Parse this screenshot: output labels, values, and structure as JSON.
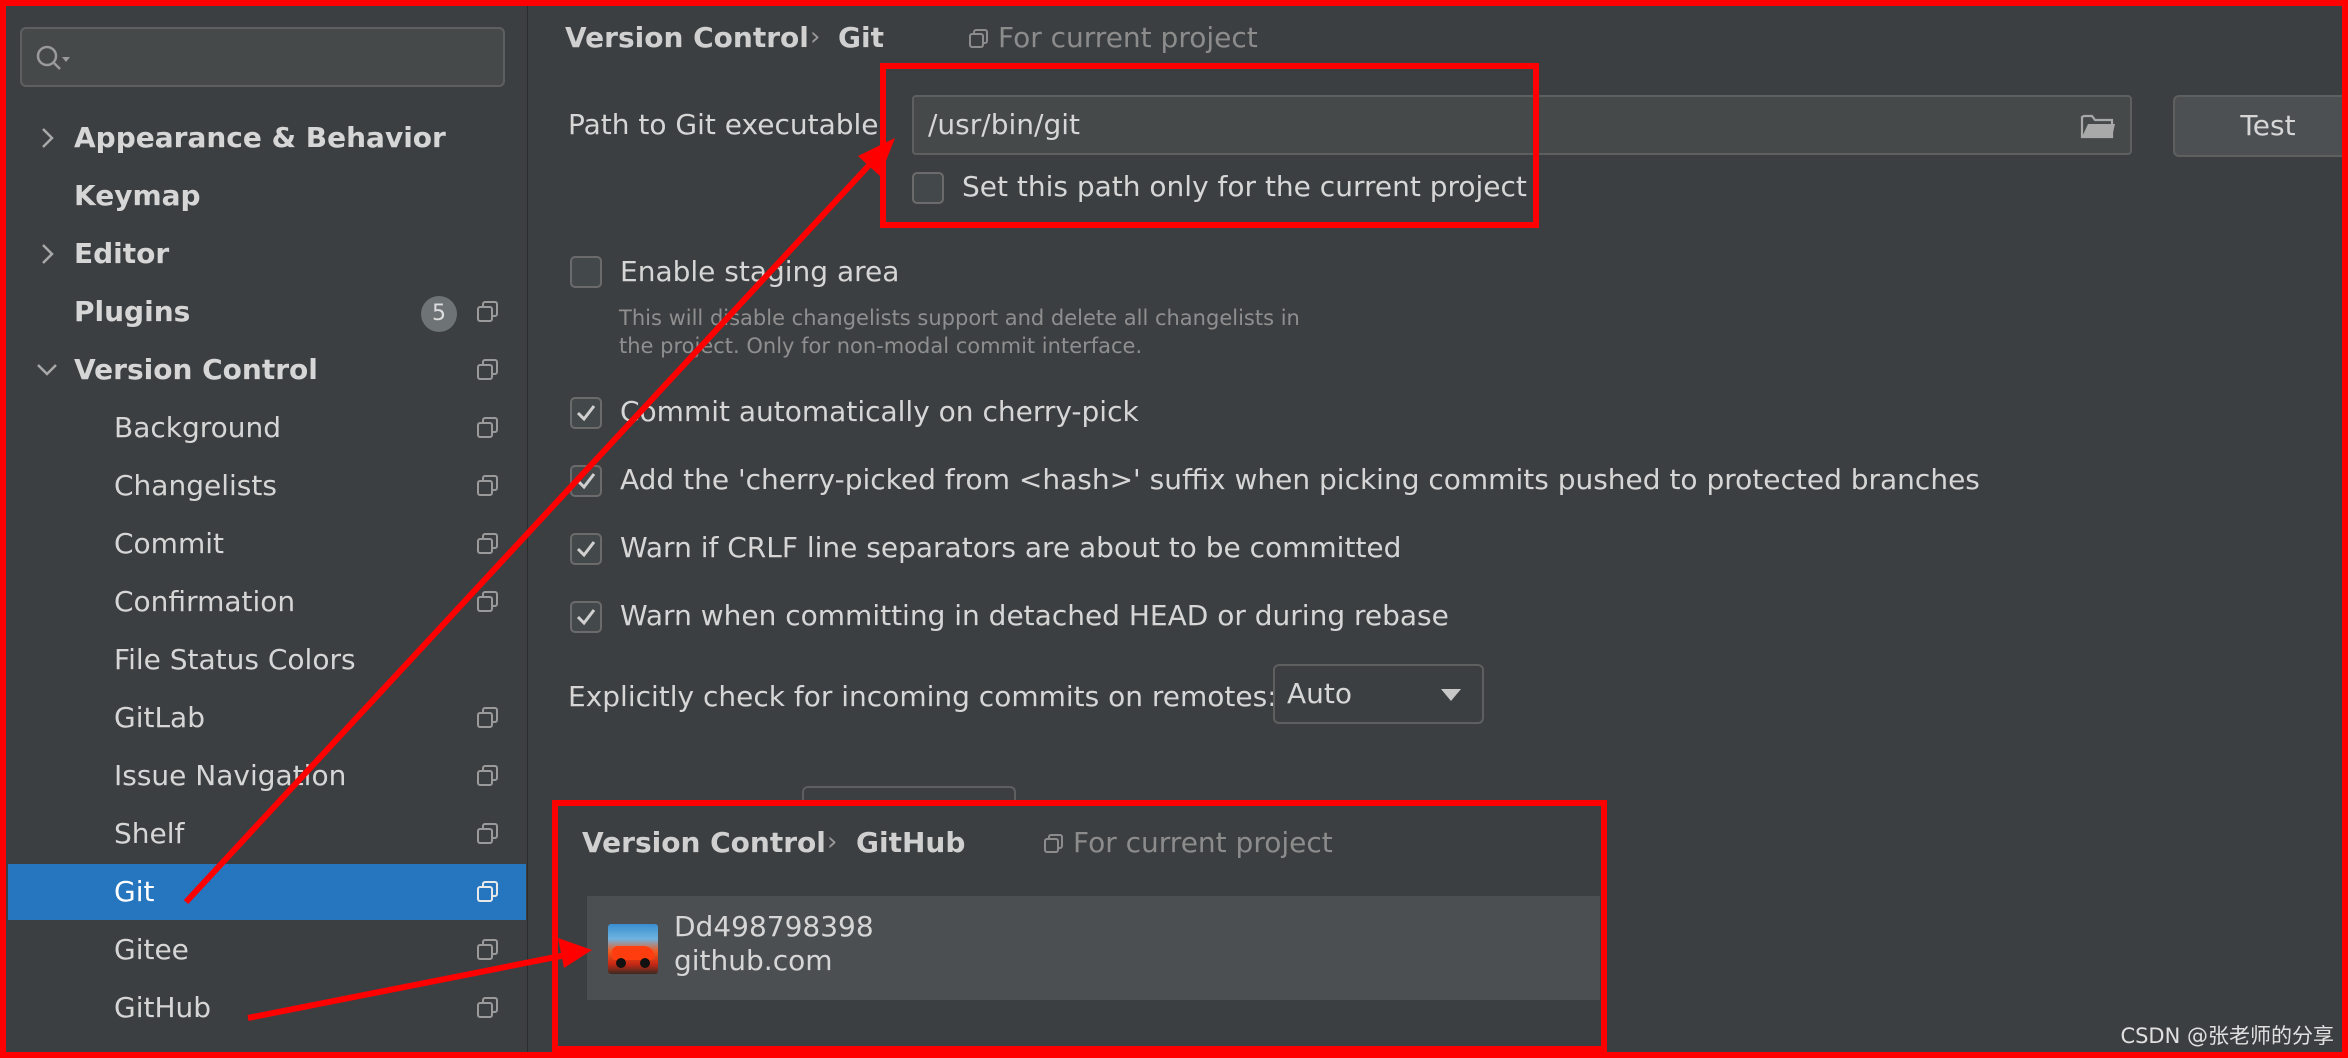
{
  "search": {
    "placeholder": ""
  },
  "sidebar": {
    "items": [
      {
        "label": "Appearance & Behavior",
        "bold": true,
        "chevron": "right"
      },
      {
        "label": "Keymap",
        "bold": true
      },
      {
        "label": "Editor",
        "bold": true,
        "chevron": "right"
      },
      {
        "label": "Plugins",
        "bold": true,
        "badge": "5",
        "copy_icon": true
      },
      {
        "label": "Version Control",
        "bold": true,
        "chevron": "down",
        "copy_icon": true
      },
      {
        "label": "Background",
        "copy_icon": true
      },
      {
        "label": "Changelists",
        "copy_icon": true
      },
      {
        "label": "Commit",
        "copy_icon": true
      },
      {
        "label": "Confirmation",
        "copy_icon": true
      },
      {
        "label": "File Status Colors"
      },
      {
        "label": "GitLab",
        "copy_icon": true
      },
      {
        "label": "Issue Navigation",
        "copy_icon": true
      },
      {
        "label": "Shelf",
        "copy_icon": true
      },
      {
        "label": "Git",
        "copy_icon": true,
        "selected": true
      },
      {
        "label": "Gitee",
        "copy_icon": true
      },
      {
        "label": "GitHub",
        "copy_icon": true
      }
    ]
  },
  "git_panel": {
    "breadcrumb": [
      "Version Control",
      "Git"
    ],
    "scope": "For current project",
    "path_label": "Path to Git executable:",
    "path_value": "/usr/bin/git",
    "test_button": "Test",
    "path_only_current": {
      "label": "Set this path only for the current project",
      "checked": false
    },
    "staging": {
      "label": "Enable staging area",
      "checked": false,
      "hint_line1": "This will disable changelists support and delete all changelists in",
      "hint_line2": "the project. Only for non-modal commit interface."
    },
    "options": [
      {
        "label": "Commit automatically on cherry-pick",
        "checked": true
      },
      {
        "label": "Add the 'cherry-picked from <hash>' suffix when picking commits pushed to protected branches",
        "checked": true
      },
      {
        "label": "Warn if CRLF line separators are about to be committed",
        "checked": true
      },
      {
        "label": "Warn when committing in detached HEAD or during rebase",
        "checked": true
      }
    ],
    "incoming_label": "Explicitly check for incoming commits on remotes:",
    "incoming_value": "Auto"
  },
  "github_panel": {
    "breadcrumb": [
      "Version Control",
      "GitHub"
    ],
    "scope": "For current project",
    "account": {
      "name": "Dd498798398",
      "server": "github.com"
    }
  },
  "watermark": "CSDN @张老师的分享",
  "colors": {
    "selection": "#2675bf",
    "annotation": "#ff0000",
    "panel_bg": "#3c3f41"
  }
}
